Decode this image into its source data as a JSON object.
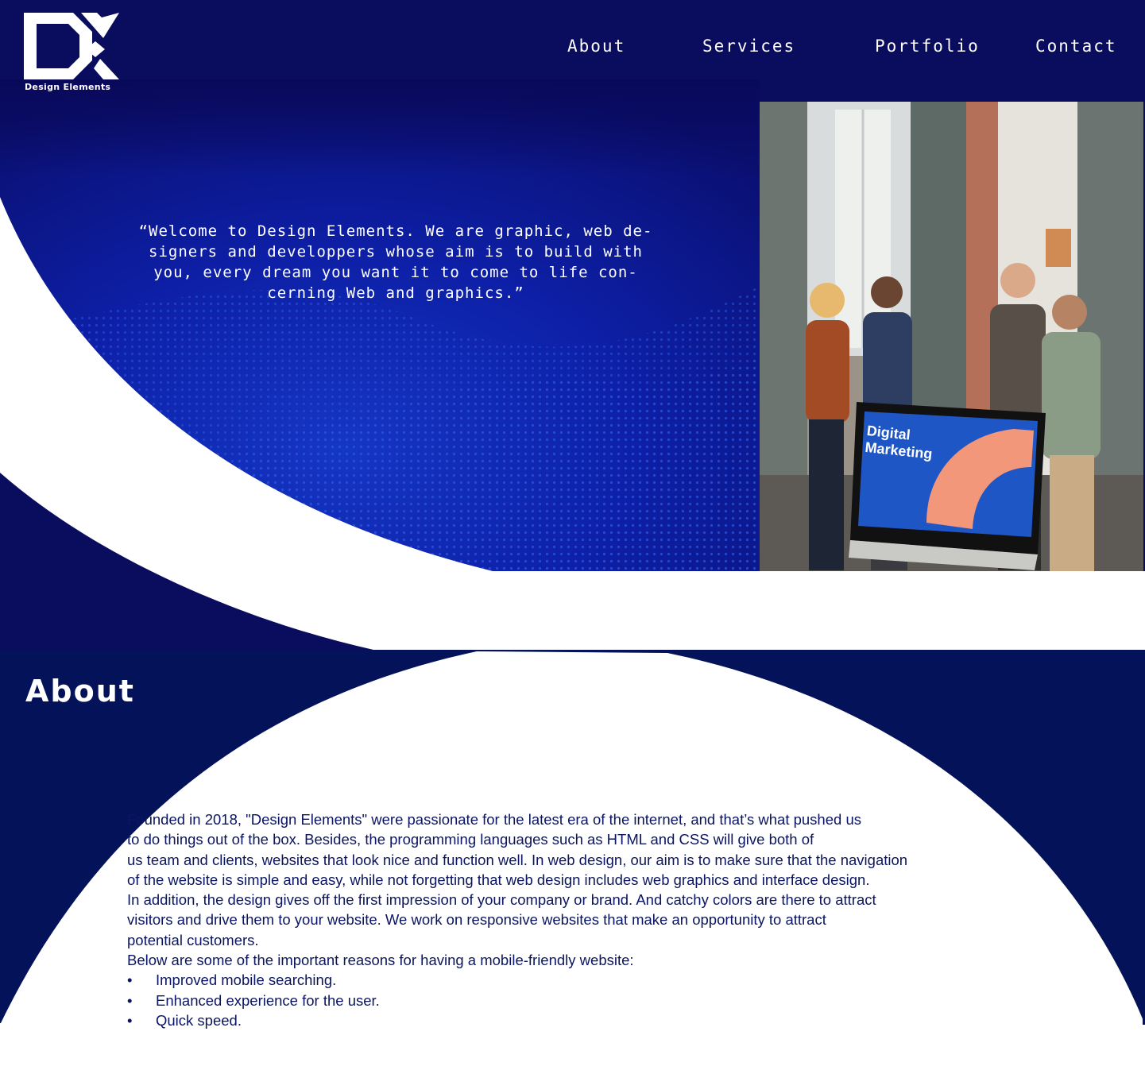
{
  "brand": {
    "logo_letters": "DK",
    "logo_caption": "Design Elements"
  },
  "nav": {
    "items": [
      {
        "label": "About"
      },
      {
        "label": "Services"
      },
      {
        "label": "Portfolio"
      },
      {
        "label": "Contact"
      }
    ]
  },
  "hero": {
    "quote": "“Welcome to Design Elements. We are graphic, web de-\nsigners and developpers whose aim is to build with\nyou, every dream you want it to come to life con-\ncerning Web and graphics.”",
    "photo_alt": "team-meeting-photo",
    "monitor_text": "Digital\nMarketing"
  },
  "about": {
    "title": "About",
    "paragraphs": [
      "Founded in 2018, \"Design Elements\" were passionate for the latest era of the internet, and that’s what pushed us\n to do things out of the box. Besides, the programming languages such as HTML and CSS will give both of\nus team and clients, websites that look nice and function well. In web design, our aim is to make sure that the navigation\nof the website is simple and easy, while not forgetting that web design includes web graphics and interface design.\nIn addition, the design gives off the first impression of your company or brand. And catchy colors are there to attract\nvisitors and drive them to your website. We work on responsive websites that make an opportunity to attract\npotential customers.\nBelow are some of the important reasons for having a mobile-friendly website:"
    ],
    "bullet_symbol": "•",
    "bullets": [
      "Improved mobile searching.",
      "Enhanced experience for the user.",
      "Quick speed."
    ]
  },
  "colors": {
    "navy": "#0a0d5e",
    "royal_blue": "#0b1a9a",
    "about_navy": "#041359",
    "text_dark": "#0b1560",
    "white": "#ffffff"
  }
}
